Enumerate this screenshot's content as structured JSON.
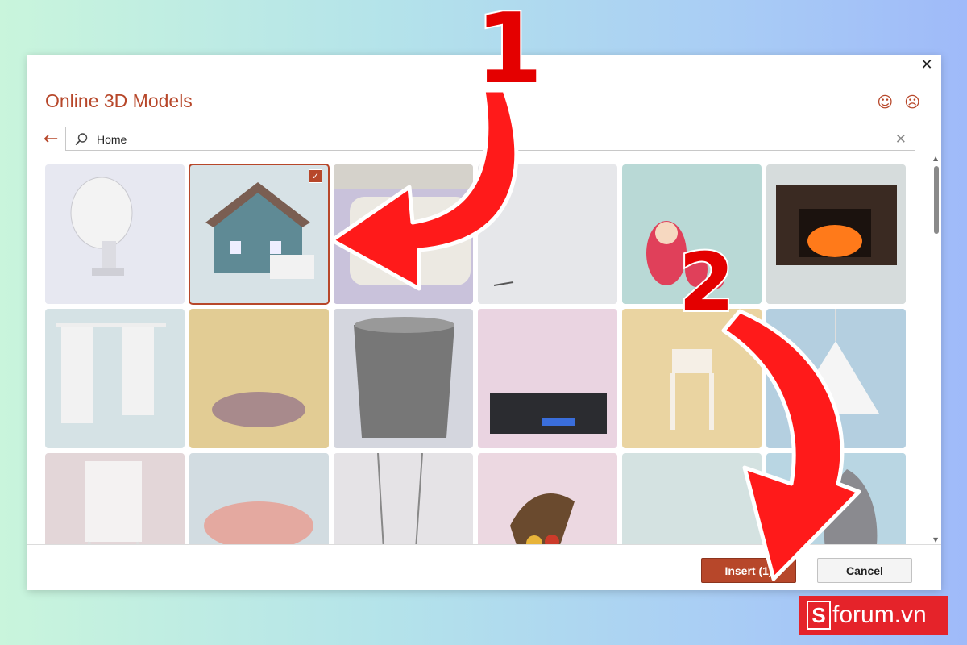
{
  "dialog": {
    "title": "Online 3D Models",
    "close_symbol": "✕",
    "feedback": {
      "smile_symbol": "☺",
      "frown_symbol": "☹"
    },
    "back_symbol": "←",
    "search": {
      "value": "Home",
      "clear_symbol": "✕"
    },
    "check_symbol": "✓",
    "models": [
      {
        "name": "satellite-dish",
        "bg": "#e7e8f1",
        "selected": false
      },
      {
        "name": "house",
        "bg": "#d7e2e6",
        "selected": true
      },
      {
        "name": "sofa",
        "bg": "#c9c2db",
        "selected": false
      },
      {
        "name": "small-object",
        "bg": "#e6e7ea",
        "selected": false
      },
      {
        "name": "matryoshka-dolls",
        "bg": "#b9d9d6",
        "selected": false
      },
      {
        "name": "fireplace",
        "bg": "#d6dcdc",
        "selected": false
      },
      {
        "name": "curtains",
        "bg": "#d5e2e5",
        "selected": false
      },
      {
        "name": "basket-tray",
        "bg": "#e2cc94",
        "selected": false
      },
      {
        "name": "waste-basket",
        "bg": "#d4d6de",
        "selected": false
      },
      {
        "name": "electronic-device",
        "bg": "#ead4e1",
        "selected": false
      },
      {
        "name": "high-chair",
        "bg": "#ead4a1",
        "selected": false
      },
      {
        "name": "pendant-lamp",
        "bg": "#b4cfe0",
        "selected": false
      },
      {
        "name": "easel",
        "bg": "#e3d6d8",
        "selected": false
      },
      {
        "name": "round-rug",
        "bg": "#d2dce1",
        "selected": false
      },
      {
        "name": "hanging-decor",
        "bg": "#e5e3e6",
        "selected": false
      },
      {
        "name": "cornucopia",
        "bg": "#ecd8e1",
        "selected": false
      },
      {
        "name": "plain-model",
        "bg": "#d4e2e1",
        "selected": false
      },
      {
        "name": "twisted-vase",
        "bg": "#b9d6e3",
        "selected": false
      }
    ],
    "buttons": {
      "insert": "Insert (1)",
      "cancel": "Cancel"
    }
  },
  "annotations": {
    "step1": "1",
    "step2": "2"
  },
  "brand": {
    "s": "S",
    "text": "forum.vn"
  },
  "colors": {
    "accent": "#b7472a",
    "annotation": "#e40000",
    "brand": "#e5232a"
  }
}
